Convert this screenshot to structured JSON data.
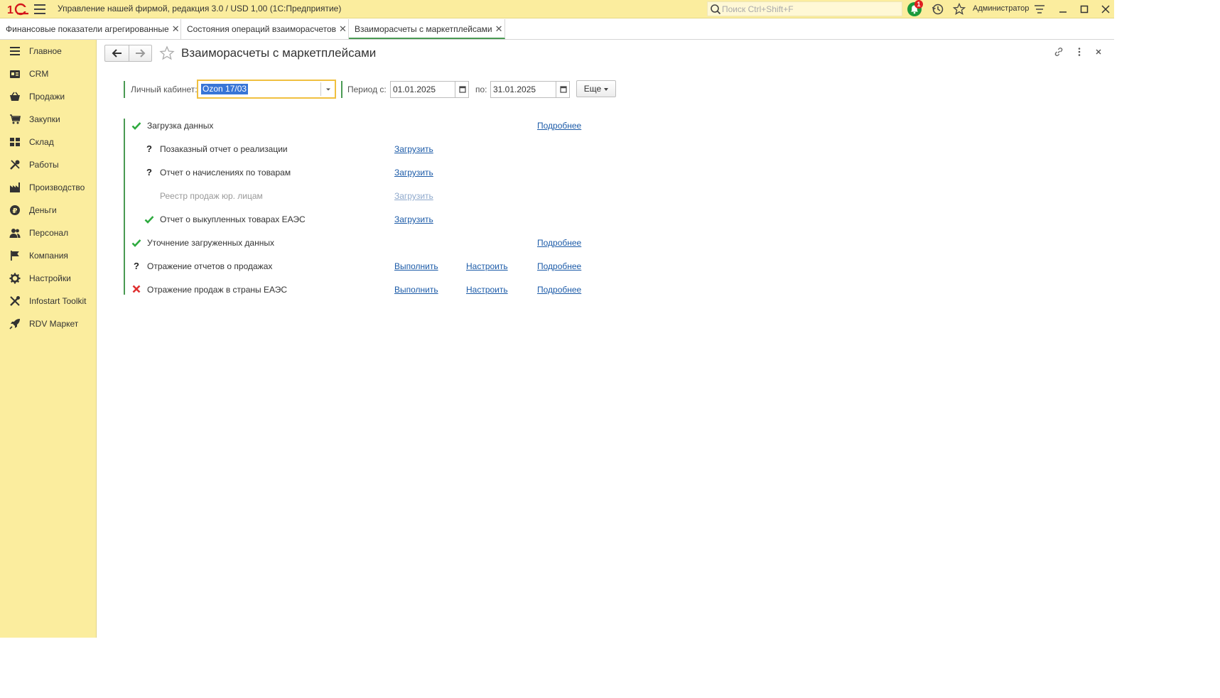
{
  "app": {
    "title": "Управление нашей фирмой, редакция 3.0 / USD 1,00  (1С:Предприятие)",
    "search_placeholder": "Поиск Ctrl+Shift+F",
    "notifications_count": "1",
    "user": "Администратор"
  },
  "tabs": [
    {
      "label": "Финансовые показатели агрегированные"
    },
    {
      "label": "Состояния операций взаиморасчетов"
    },
    {
      "label": "Взаиморасчеты с маркетплейсами"
    }
  ],
  "sidebar": {
    "items": [
      {
        "label": "Главное",
        "icon": "menu-icon"
      },
      {
        "label": "CRM",
        "icon": "crm-icon"
      },
      {
        "label": "Продажи",
        "icon": "basket-icon"
      },
      {
        "label": "Закупки",
        "icon": "cart-icon"
      },
      {
        "label": "Склад",
        "icon": "warehouse-icon"
      },
      {
        "label": "Работы",
        "icon": "tools-icon"
      },
      {
        "label": "Производство",
        "icon": "factory-icon"
      },
      {
        "label": "Деньги",
        "icon": "ruble-icon"
      },
      {
        "label": "Персонал",
        "icon": "people-icon"
      },
      {
        "label": "Компания",
        "icon": "flag-icon"
      },
      {
        "label": "Настройки",
        "icon": "gear-icon"
      },
      {
        "label": "Infostart Toolkit",
        "icon": "toolkit-icon"
      },
      {
        "label": "RDV Маркет",
        "icon": "rocket-icon"
      }
    ]
  },
  "page": {
    "title": "Взаиморасчеты с маркетплейсами",
    "filters": {
      "account_label": "Личный кабинет:",
      "account_value": "Ozon 17/03",
      "period_from_label": "Период с:",
      "period_from": "01.01.2025",
      "period_to_label": "по:",
      "period_to": "31.01.2025",
      "more_label": "Еще"
    },
    "steps": [
      {
        "status": "ok",
        "label": "Загрузка данных",
        "details": "Подробнее"
      },
      {
        "status": "question",
        "label": "Позаказный отчет о реализации",
        "load": "Загрузить"
      },
      {
        "status": "question",
        "label": "Отчет о начислениях по товарам",
        "load": "Загрузить"
      },
      {
        "status": "none",
        "label": "Реестр продаж юр. лицам",
        "load": "Загрузить"
      },
      {
        "status": "ok",
        "label": "Отчет о выкупленных товарах ЕАЭС",
        "load": "Загрузить"
      },
      {
        "status": "ok",
        "label": "Уточнение загруженных данных",
        "details": "Подробнее"
      },
      {
        "status": "question",
        "label": "Отражение отчетов о продажах",
        "run": "Выполнить",
        "configure": "Настроить",
        "details": "Подробнее"
      },
      {
        "status": "error",
        "label": "Отражение продаж в страны ЕАЭС",
        "run": "Выполнить",
        "configure": "Настроить",
        "details": "Подробнее"
      }
    ]
  },
  "colors": {
    "accent_yellow": "#fbed9e",
    "ok_green": "#2eaa3f",
    "error_red": "#e03030",
    "link_blue": "#1c5ba8",
    "bar_green": "#4a9a53"
  }
}
